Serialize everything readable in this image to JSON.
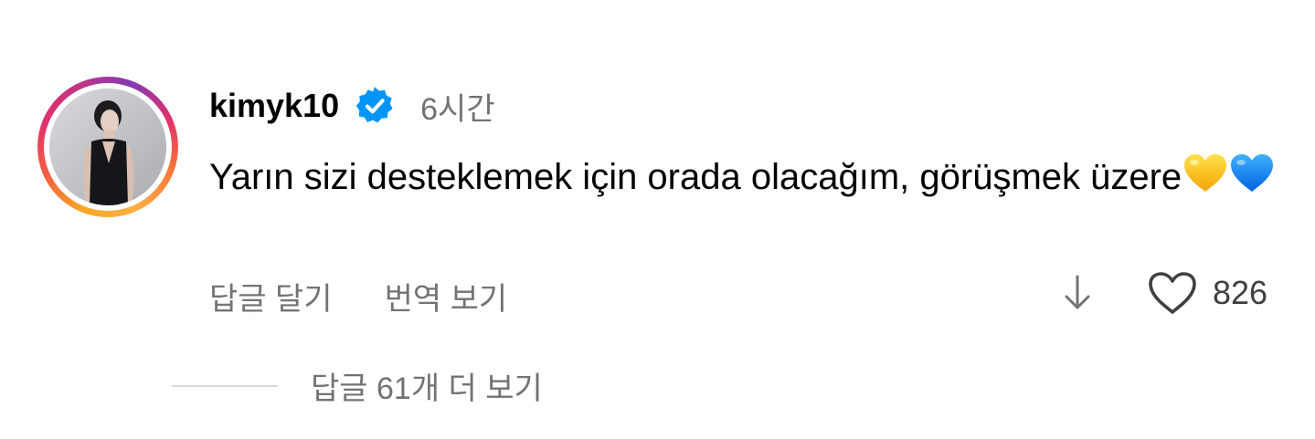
{
  "comment": {
    "username": "kimyk10",
    "verified": true,
    "time_ago": "6시간",
    "text": "Yarın sizi desteklemek için orada olacağım, görüşmek üzere",
    "emojis": [
      "yellow-heart-emoji",
      "blue-heart-emoji"
    ],
    "actions": {
      "reply_label": "답글 달기",
      "translate_label": "번역 보기"
    },
    "like_count": "826",
    "view_replies_label": "답글 61개 더 보기"
  },
  "icons": {
    "verified": "verified-badge-icon",
    "down": "arrow-down-icon",
    "like": "heart-outline-icon"
  },
  "colors": {
    "verified_blue": "#0095f6",
    "secondary_text": "#737373",
    "yellow_heart": "#fdc21c",
    "blue_heart": "#1a8cff"
  }
}
